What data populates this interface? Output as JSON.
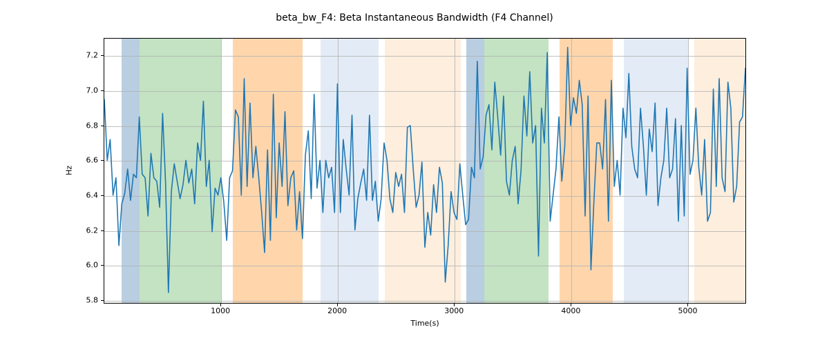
{
  "chart_data": {
    "type": "line",
    "title": "beta_bw_F4: Beta Instantaneous Bandwidth (F4 Channel)",
    "xlabel": "Time(s)",
    "ylabel": "Hz",
    "xlim": [
      0,
      5500
    ],
    "ylim": [
      5.78,
      7.3
    ],
    "xticks": [
      1000,
      2000,
      3000,
      4000,
      5000
    ],
    "yticks": [
      5.8,
      6.0,
      6.2,
      6.4,
      6.6,
      6.8,
      7.0,
      7.2
    ],
    "bands": [
      {
        "x0": 150,
        "x1": 300,
        "color": "#b9cee1"
      },
      {
        "x0": 300,
        "x1": 1000,
        "color": "#c3e3c3"
      },
      {
        "x0": 1100,
        "x1": 1700,
        "color": "#ffd6ac"
      },
      {
        "x0": 1850,
        "x1": 2350,
        "color": "#e3ecf6"
      },
      {
        "x0": 2400,
        "x1": 3050,
        "color": "#fdeedd"
      },
      {
        "x0": 3100,
        "x1": 3250,
        "color": "#b9cee1"
      },
      {
        "x0": 3250,
        "x1": 3800,
        "color": "#c3e3c3"
      },
      {
        "x0": 3900,
        "x1": 4350,
        "color": "#ffd6ac"
      },
      {
        "x0": 4450,
        "x1": 5000,
        "color": "#e3ecf6"
      },
      {
        "x0": 5050,
        "x1": 5500,
        "color": "#fdeedd"
      }
    ],
    "series": [
      {
        "name": "beta_bw_F4",
        "color": "#1f77b4",
        "x_step": 25,
        "x_start": 0,
        "values": [
          6.95,
          6.6,
          6.72,
          6.4,
          6.5,
          6.11,
          6.35,
          6.41,
          6.55,
          6.37,
          6.52,
          6.5,
          6.85,
          6.52,
          6.5,
          6.28,
          6.64,
          6.5,
          6.48,
          6.33,
          6.87,
          6.48,
          5.84,
          6.42,
          6.58,
          6.48,
          6.38,
          6.46,
          6.6,
          6.47,
          6.55,
          6.35,
          6.7,
          6.6,
          6.94,
          6.45,
          6.6,
          6.19,
          6.44,
          6.4,
          6.5,
          6.36,
          6.14,
          6.5,
          6.54,
          6.89,
          6.85,
          6.4,
          7.07,
          6.45,
          6.93,
          6.5,
          6.68,
          6.5,
          6.3,
          6.07,
          6.66,
          6.14,
          6.98,
          6.27,
          6.7,
          6.45,
          6.88,
          6.34,
          6.5,
          6.54,
          6.2,
          6.42,
          6.15,
          6.63,
          6.77,
          6.38,
          6.98,
          6.44,
          6.6,
          6.3,
          6.6,
          6.5,
          6.56,
          6.3,
          7.04,
          6.3,
          6.72,
          6.55,
          6.4,
          6.86,
          6.2,
          6.38,
          6.47,
          6.55,
          6.37,
          6.86,
          6.37,
          6.48,
          6.25,
          6.38,
          6.7,
          6.6,
          6.38,
          6.3,
          6.53,
          6.45,
          6.52,
          6.3,
          6.79,
          6.8,
          6.55,
          6.33,
          6.4,
          6.59,
          6.1,
          6.3,
          6.17,
          6.46,
          6.3,
          6.56,
          6.47,
          5.9,
          6.11,
          6.42,
          6.3,
          6.26,
          6.58,
          6.4,
          6.23,
          6.26,
          6.56,
          6.5,
          7.17,
          6.55,
          6.62,
          6.86,
          6.92,
          6.66,
          7.05,
          6.85,
          6.63,
          6.97,
          6.48,
          6.4,
          6.6,
          6.68,
          6.35,
          6.54,
          6.97,
          6.74,
          7.11,
          6.7,
          6.8,
          6.05,
          6.9,
          6.7,
          7.22,
          6.25,
          6.4,
          6.55,
          6.85,
          6.48,
          6.68,
          7.25,
          6.8,
          6.96,
          6.87,
          7.06,
          6.92,
          6.28,
          6.97,
          5.97,
          6.36,
          6.7,
          6.7,
          6.55,
          6.95,
          6.25,
          7.06,
          6.45,
          6.6,
          6.4,
          6.9,
          6.73,
          7.1,
          6.68,
          6.55,
          6.5,
          6.9,
          6.68,
          6.4,
          6.78,
          6.65,
          6.93,
          6.34,
          6.5,
          6.6,
          6.9,
          6.5,
          6.55,
          6.84,
          6.25,
          6.8,
          6.28,
          7.13,
          6.52,
          6.6,
          6.9,
          6.56,
          6.4,
          6.72,
          6.25,
          6.3,
          7.01,
          6.45,
          7.07,
          6.5,
          6.42,
          7.05,
          6.9,
          6.36,
          6.45,
          6.82,
          6.85,
          7.13
        ]
      }
    ]
  }
}
